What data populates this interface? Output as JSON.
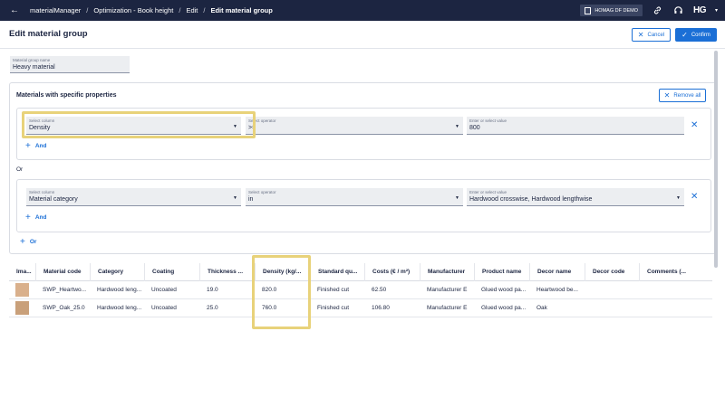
{
  "topbar": {
    "breadcrumb": [
      "materialManager",
      "Optimization - Book height",
      "Edit",
      "Edit material group"
    ],
    "separator": "/",
    "company": "HOMAG DF DEMO",
    "logo": "HG"
  },
  "header": {
    "title": "Edit material group",
    "cancel_label": "Cancel",
    "confirm_label": "Confirm"
  },
  "group_name": {
    "label": "Material group name",
    "value": "Heavy material"
  },
  "materials": {
    "title": "Materials with specific properties",
    "remove_all_label": "Remove all",
    "or_text": "Or",
    "add_or_label": "Or",
    "add_and_label": "And",
    "rules": [
      {
        "column_label": "Select column",
        "column_value": "Density",
        "operator_label": "Select operator",
        "operator_value": ">=",
        "value_label": "Enter or select value",
        "value_value": "800"
      },
      {
        "column_label": "Select column",
        "column_value": "Material category",
        "operator_label": "Select operator",
        "operator_value": "in",
        "value_label": "Enter or select value",
        "value_value": "Hardwood crosswise, Hardwood lengthwise"
      }
    ]
  },
  "table": {
    "headers": [
      "Ima...",
      "Material code",
      "Category",
      "Coating",
      "Thickness ...",
      "Density (kg/...",
      "Standard qu...",
      "Costs (€ / m²)",
      "Manufacturer",
      "Product name",
      "Decor name",
      "Decor code",
      "Comments (..."
    ],
    "rows": [
      {
        "thumb_color": "#d9b08c",
        "cells": [
          "SWP_Heartwo...",
          "Hardwood leng...",
          "Uncoated",
          "19.0",
          "820.0",
          "Finished cut",
          "62.50",
          "Manufacturer E",
          "Glued wood pa...",
          "Heartwood be...",
          "",
          ""
        ]
      },
      {
        "thumb_color": "#c9a07a",
        "cells": [
          "SWP_Oak_25.0",
          "Hardwood leng...",
          "Uncoated",
          "25.0",
          "760.0",
          "Finished cut",
          "106.80",
          "Manufacturer E",
          "Glued wood pa...",
          "Oak",
          "",
          ""
        ]
      }
    ]
  },
  "colors": {
    "accent": "#1b6fd6",
    "topbar": "#1c2541",
    "highlight": "#e8d27a"
  }
}
